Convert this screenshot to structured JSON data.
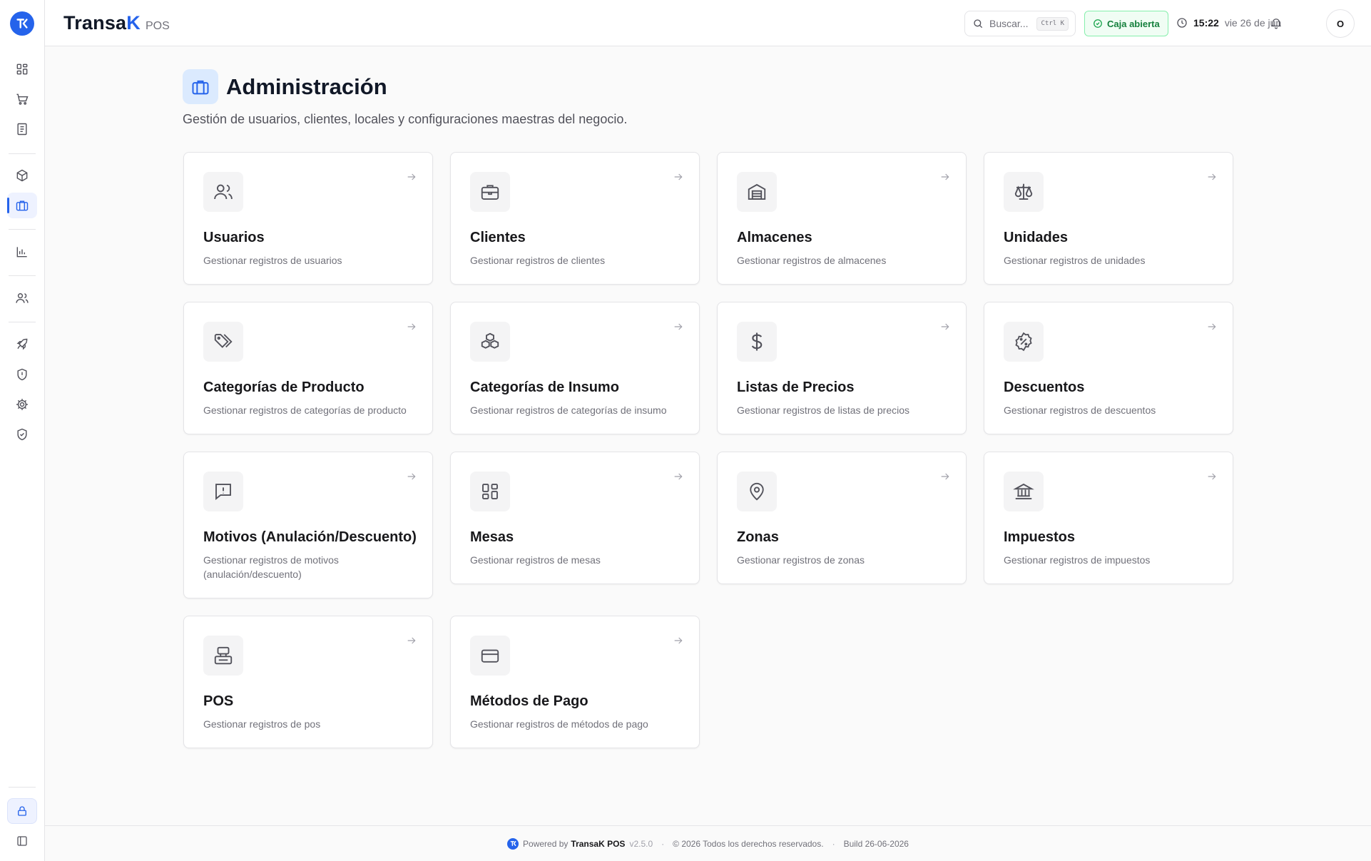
{
  "header": {
    "brand_name_prefix": "Transa",
    "brand_name_accent": "K",
    "brand_suffix": "POS",
    "search_placeholder": "Buscar...",
    "search_shortcut": "Ctrl K",
    "cash_status": "Caja abierta",
    "time": "15:22",
    "date": "vie 26 de jun",
    "avatar_initial": "O"
  },
  "sidebar": {
    "items": [
      {
        "icon": "dashboard-icon"
      },
      {
        "icon": "cart-icon"
      },
      {
        "icon": "receipt-icon"
      },
      {
        "icon": "package-icon"
      },
      {
        "icon": "briefcase-icon",
        "active": true
      },
      {
        "icon": "bar-chart-icon"
      },
      {
        "icon": "users-icon"
      },
      {
        "icon": "rocket-icon"
      },
      {
        "icon": "shield-alert-icon"
      },
      {
        "icon": "gear-icon"
      },
      {
        "icon": "shield-check-icon"
      }
    ],
    "bottom": [
      {
        "icon": "lock-icon"
      },
      {
        "icon": "panel-toggle-icon"
      }
    ]
  },
  "page": {
    "title": "Administración",
    "subtitle": "Gestión de usuarios, clientes, locales y configuraciones maestras del negocio."
  },
  "cards": [
    {
      "title": "Usuarios",
      "desc": "Gestionar registros de usuarios",
      "icon": "users-icon"
    },
    {
      "title": "Clientes",
      "desc": "Gestionar registros de clientes",
      "icon": "briefcase-icon"
    },
    {
      "title": "Almacenes",
      "desc": "Gestionar registros de almacenes",
      "icon": "warehouse-icon"
    },
    {
      "title": "Unidades",
      "desc": "Gestionar registros de unidades",
      "icon": "scale-icon"
    },
    {
      "title": "Categorías de Producto",
      "desc": "Gestionar registros de categorías de producto",
      "icon": "tags-icon"
    },
    {
      "title": "Categorías de Insumo",
      "desc": "Gestionar registros de categorías de insumo",
      "icon": "boxes-icon"
    },
    {
      "title": "Listas de Precios",
      "desc": "Gestionar registros de listas de precios",
      "icon": "dollar-icon"
    },
    {
      "title": "Descuentos",
      "desc": "Gestionar registros de descuentos",
      "icon": "discount-badge-icon"
    },
    {
      "title": "Motivos (Anulación/Descuento)",
      "desc": "Gestionar registros de motivos (anulación/descuento)",
      "icon": "message-alert-icon"
    },
    {
      "title": "Mesas",
      "desc": "Gestionar registros de mesas",
      "icon": "layout-grid-icon"
    },
    {
      "title": "Zonas",
      "desc": "Gestionar registros de zonas",
      "icon": "map-pin-icon"
    },
    {
      "title": "Impuestos",
      "desc": "Gestionar registros de impuestos",
      "icon": "landmark-icon"
    },
    {
      "title": "POS",
      "desc": "Gestionar registros de pos",
      "icon": "pos-terminal-icon"
    },
    {
      "title": "Métodos de Pago",
      "desc": "Gestionar registros de métodos de pago",
      "icon": "credit-card-icon"
    }
  ],
  "footer": {
    "powered_by": "Powered by",
    "product": "TransaK POS",
    "version": "v2.5.0",
    "copyright": "© 2026 Todos los derechos reservados.",
    "build": "Build 26-06-2026"
  },
  "colors": {
    "accent": "#2563eb",
    "cash_open": "#15803d",
    "background": "#fafafa"
  }
}
